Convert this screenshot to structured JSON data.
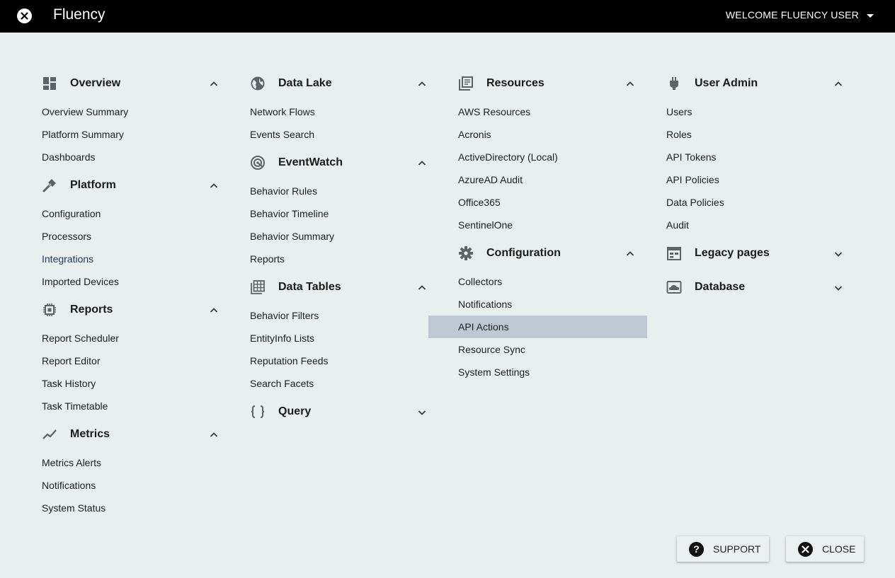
{
  "header": {
    "app_title": "Fluency",
    "welcome": "WELCOME FLUENCY USER"
  },
  "columns": [
    {
      "sections": [
        {
          "title": "Overview",
          "icon": "dashboard-icon",
          "expanded": true,
          "items": [
            "Overview Summary",
            "Platform Summary",
            "Dashboards"
          ]
        },
        {
          "title": "Platform",
          "icon": "hammer-icon",
          "expanded": true,
          "items": [
            "Configuration",
            "Processors",
            "Integrations",
            "Imported Devices"
          ]
        },
        {
          "title": "Reports",
          "icon": "chip-icon",
          "expanded": true,
          "items": [
            "Report Scheduler",
            "Report Editor",
            "Task History",
            "Task Timetable"
          ]
        },
        {
          "title": "Metrics",
          "icon": "trend-line-icon",
          "expanded": true,
          "items": [
            "Metrics Alerts",
            "Notifications",
            "System Status"
          ]
        }
      ]
    },
    {
      "sections": [
        {
          "title": "Data Lake",
          "icon": "globe-icon",
          "expanded": true,
          "items": [
            "Network Flows",
            "Events Search"
          ]
        },
        {
          "title": "EventWatch",
          "icon": "radar-icon",
          "expanded": true,
          "items": [
            "Behavior Rules",
            "Behavior Timeline",
            "Behavior Summary",
            "Reports"
          ]
        },
        {
          "title": "Data Tables",
          "icon": "table-icon",
          "expanded": true,
          "items": [
            "Behavior Filters",
            "EntityInfo Lists",
            "Reputation Feeds",
            "Search Facets"
          ]
        },
        {
          "title": "Query",
          "icon": "braces-icon",
          "expanded": false,
          "items": []
        }
      ]
    },
    {
      "sections": [
        {
          "title": "Resources",
          "icon": "library-icon",
          "expanded": true,
          "items": [
            "AWS Resources",
            "Acronis",
            "ActiveDirectory (Local)",
            "AzureAD Audit",
            "Office365",
            "SentinelOne"
          ]
        },
        {
          "title": "Configuration",
          "icon": "gear-icon",
          "expanded": true,
          "items": [
            "Collectors",
            "Notifications",
            "API Actions",
            "Resource Sync",
            "System Settings"
          ]
        }
      ]
    },
    {
      "sections": [
        {
          "title": "User Admin",
          "icon": "plug-icon",
          "expanded": true,
          "items": [
            "Users",
            "Roles",
            "API Tokens",
            "API Policies",
            "Data Policies",
            "Audit"
          ]
        },
        {
          "title": "Legacy pages",
          "icon": "calendar-icon",
          "expanded": false,
          "items": []
        },
        {
          "title": "Database",
          "icon": "cloud-storage-icon",
          "expanded": false,
          "items": []
        }
      ]
    }
  ],
  "highlight": {
    "link_item": "Integrations",
    "active_item": "API Actions"
  },
  "footer": {
    "support_label": "SUPPORT",
    "close_label": "CLOSE"
  },
  "colors": {
    "background": "#e9eeee",
    "topbar": "#000000",
    "active_row": "#bcc8d3",
    "link_text": "#1f3f63",
    "icon_gray": "#5f6368"
  }
}
